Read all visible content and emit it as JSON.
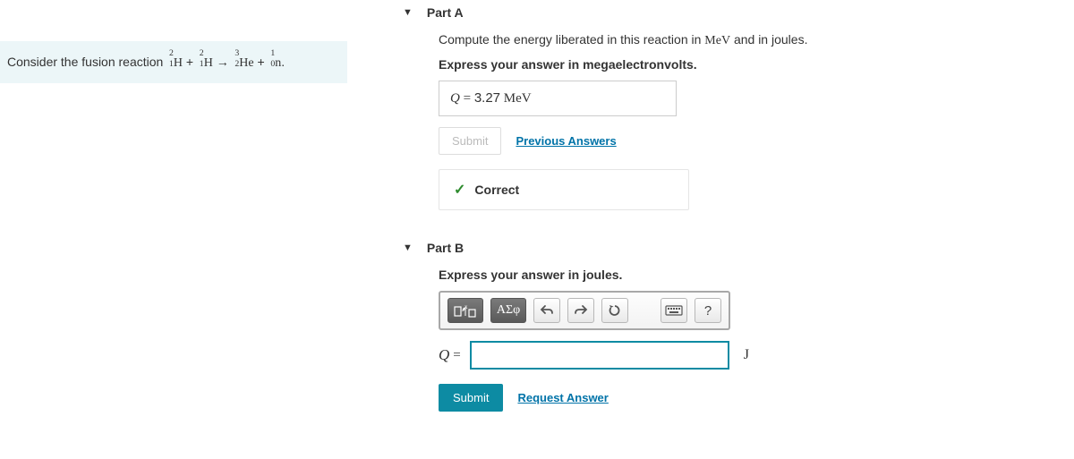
{
  "prompt": {
    "intro": "Consider the fusion reaction ",
    "s1a": "2",
    "s1z": "1",
    "s1e": "H",
    "plus": " + ",
    "s2a": "2",
    "s2z": "1",
    "s2e": "H",
    "arrow": " → ",
    "s3a": "3",
    "s3z": "2",
    "s3e": "He",
    "s4a": "1",
    "s4z": "0",
    "s4e": "n",
    "period": "."
  },
  "partA": {
    "title": "Part A",
    "question": "Compute the energy liberated in this reaction in MeV and in joules.",
    "instruction": "Express your answer in megaelectronvolts.",
    "answer_var": "Q",
    "answer_eq": " = ",
    "answer_val": "3.27",
    "answer_unit": " MeV",
    "submit_label": "Submit",
    "prev_label": "Previous Answers",
    "correct_label": "Correct"
  },
  "partB": {
    "title": "Part B",
    "instruction": "Express your answer in joules.",
    "toolbar": {
      "templates_hint": "templates",
      "symbols_label": "ΑΣφ",
      "undo_hint": "undo",
      "redo_hint": "redo",
      "reset_hint": "reset",
      "keyboard_hint": "keyboard",
      "help_label": "?"
    },
    "answer_var": "Q",
    "eq": " =",
    "input_value": "",
    "unit": "J",
    "submit_label": "Submit",
    "request_label": "Request Answer"
  }
}
